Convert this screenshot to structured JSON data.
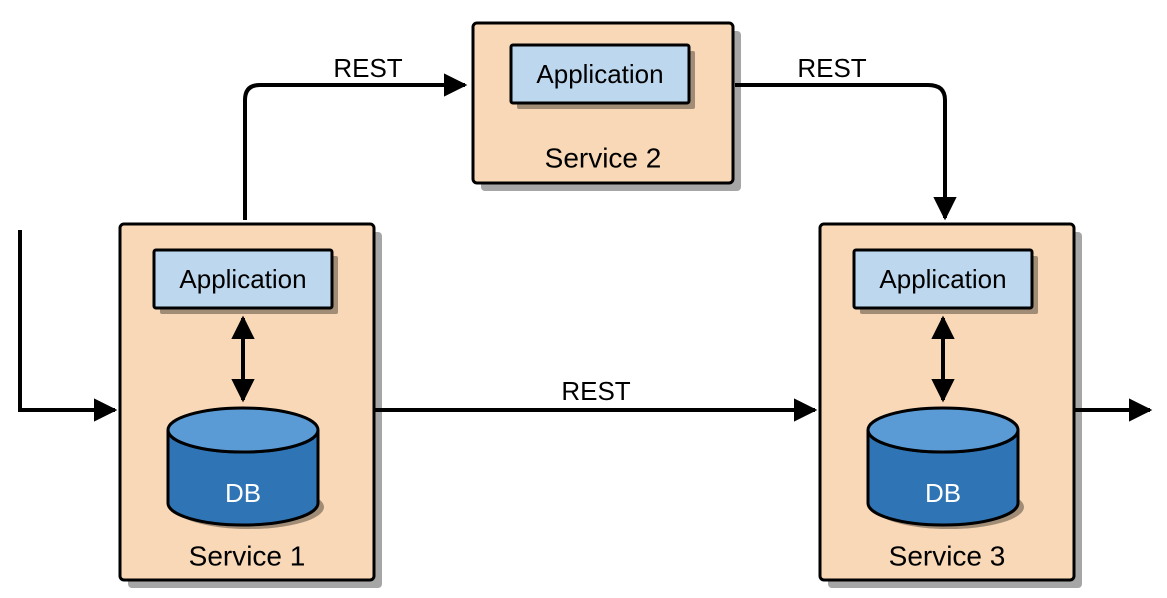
{
  "nodes": {
    "s1": {
      "title": "Service 1",
      "app_label": "Application",
      "db_label": "DB"
    },
    "s2": {
      "title": "Service 2",
      "app_label": "Application"
    },
    "s3": {
      "title": "Service 3",
      "app_label": "Application",
      "db_label": "DB"
    }
  },
  "edges": {
    "s1_s2": "REST",
    "s2_s3": "REST",
    "s1_s3": "REST"
  }
}
